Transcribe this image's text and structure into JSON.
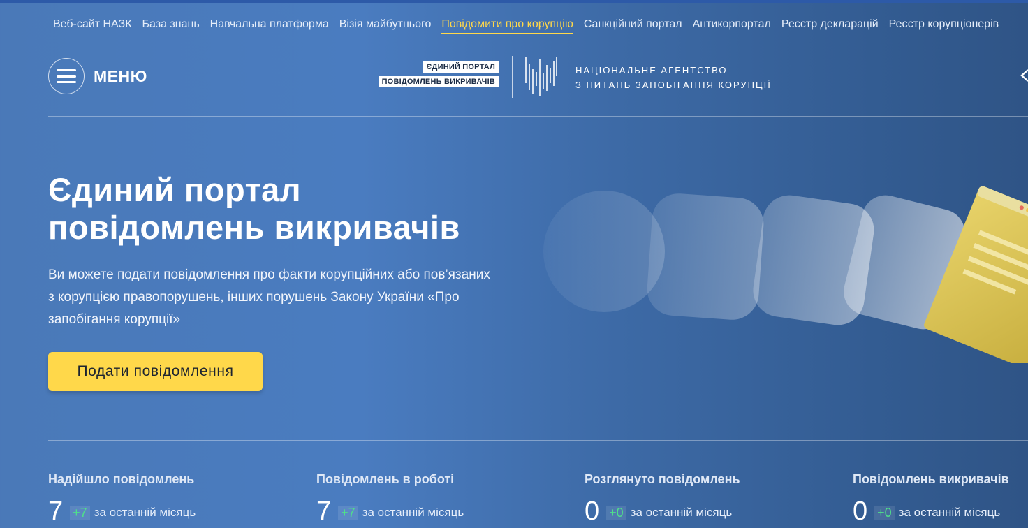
{
  "topnav": {
    "links": [
      {
        "label": "Веб-сайт НАЗК"
      },
      {
        "label": "База знань"
      },
      {
        "label": "Навчальна платформа"
      },
      {
        "label": "Візія майбутнього"
      },
      {
        "label": "Повідомити про корупцію",
        "active": true
      },
      {
        "label": "Санкційний портал"
      },
      {
        "label": "Антикорпортал"
      },
      {
        "label": "Реєстр декларацій"
      },
      {
        "label": "Реєстр корупціонерів"
      }
    ]
  },
  "header": {
    "menu_label": "МЕНЮ",
    "portal_tag_1": "ЄДИНИЙ ПОРТАЛ",
    "portal_tag_2": "ПОВІДОМЛЕНЬ ВИКРИВАЧІВ",
    "agency_line_1": "НАЦІОНАЛЬНЕ АГЕНТСТВО",
    "agency_line_2": "З ПИТАНЬ ЗАПОБІГАННЯ КОРУПЦІЇ"
  },
  "hero": {
    "title_line_1": "Єдиний портал",
    "title_line_2": "повідомлень викривачів",
    "description": "Ви можете подати повідомлення про факти корупційних або пов’язаних з корупцією правопорушень, інших порушень Закону України «Про запобігання корупції»",
    "cta_label": "Подати повідомлення"
  },
  "stats": [
    {
      "label": "Надійшло повідомлень",
      "value": "7",
      "delta": "+7",
      "period": "за останній місяць"
    },
    {
      "label": "Повідомлень в роботі",
      "value": "7",
      "delta": "+7",
      "period": "за останній місяць"
    },
    {
      "label": "Розглянуто повідомлень",
      "value": "0",
      "delta": "+0",
      "period": "за останній місяць"
    },
    {
      "label": "Повідомлень викривачів",
      "value": "0",
      "delta": "+0",
      "period": "за останній місяць"
    }
  ],
  "colors": {
    "accent_yellow": "#ffd84a",
    "delta_green": "#4fe08a",
    "background_blue": "#4a7cc0"
  },
  "icons": [
    "menu-icon",
    "nazk-logo-icon",
    "chevron-left-icon"
  ]
}
